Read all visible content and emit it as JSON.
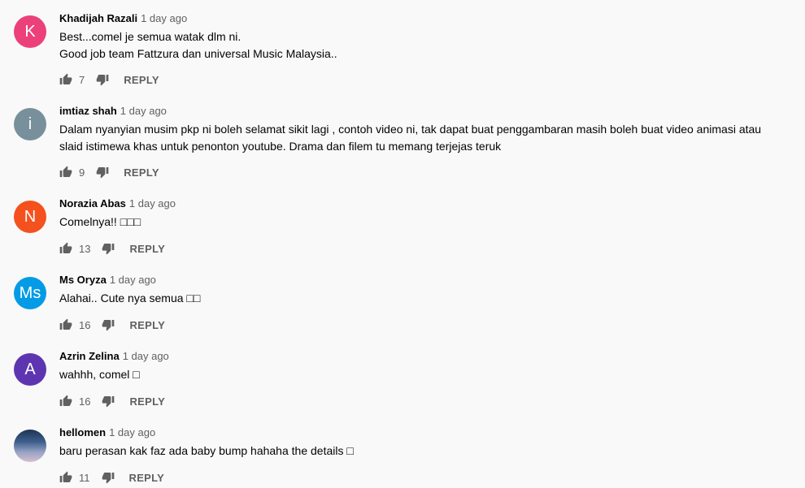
{
  "comments": [
    {
      "author": "Khadijah Razali",
      "time": "1 day ago",
      "lines": [
        "Best...comel je semua watak dlm ni.",
        "Good job team Fattzura dan universal Music Malaysia.."
      ],
      "likes": "7",
      "reply": "REPLY",
      "avatar_letter": "K",
      "avatar_color": "#ec407a"
    },
    {
      "author": "imtiaz shah",
      "time": "1 day ago",
      "lines": [
        "Dalam nyanyian musim pkp ni boleh selamat sikit lagi , contoh video ni, tak dapat buat penggambaran masih boleh buat video animasi atau",
        "slaid istimewa khas untuk penonton youtube. Drama dan filem tu memang terjejas teruk"
      ],
      "likes": "9",
      "reply": "REPLY",
      "avatar_letter": "i",
      "avatar_color": "#78909c"
    },
    {
      "author": "Norazia Abas",
      "time": "1 day ago",
      "lines": [
        "Comelnya!! □□□"
      ],
      "likes": "13",
      "reply": "REPLY",
      "avatar_letter": "N",
      "avatar_color": "#f4511e"
    },
    {
      "author": "Ms Oryza",
      "time": "1 day ago",
      "lines": [
        "Alahai.. Cute nya semua □□"
      ],
      "likes": "16",
      "reply": "REPLY",
      "avatar_letter": "Ms",
      "avatar_color": "#039be5"
    },
    {
      "author": "Azrin Zelina",
      "time": "1 day ago",
      "lines": [
        "wahhh, comel □"
      ],
      "likes": "16",
      "reply": "REPLY",
      "avatar_letter": "A",
      "avatar_color": "#5e35b1"
    },
    {
      "author": "hellomen",
      "time": "1 day ago",
      "lines": [
        "baru perasan kak faz ada baby bump hahaha the details □"
      ],
      "likes": "11",
      "reply": "REPLY",
      "avatar_letter": "",
      "avatar_color": "#3d5f8d"
    }
  ],
  "icons": {
    "like": "thumb-up-icon",
    "dislike": "thumb-down-icon"
  }
}
